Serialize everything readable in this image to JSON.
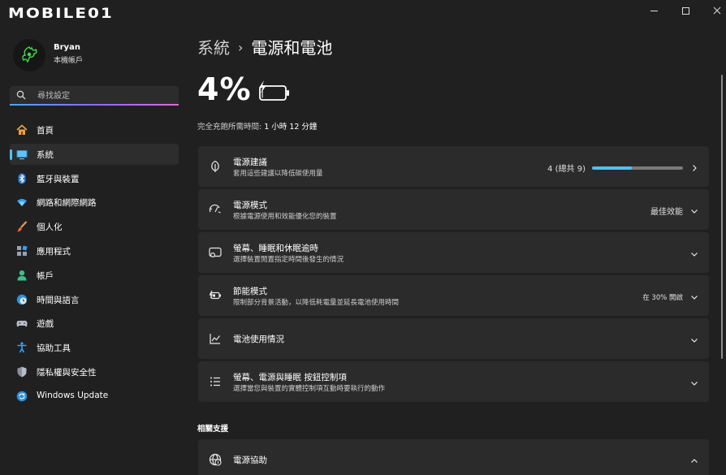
{
  "brand": {
    "logo_text": "MOBILE01"
  },
  "window": {
    "controls": [
      "minimize",
      "maximize",
      "close"
    ]
  },
  "profile": {
    "name": "Bryan",
    "account_type": "本機帳戶"
  },
  "search": {
    "placeholder": "尋找設定"
  },
  "sidebar": {
    "items": [
      {
        "label": "首頁",
        "icon": "home-icon",
        "active": false
      },
      {
        "label": "系統",
        "icon": "system-icon",
        "active": true
      },
      {
        "label": "藍牙與裝置",
        "icon": "bluetooth-icon",
        "active": false
      },
      {
        "label": "網路和網際網路",
        "icon": "wifi-icon",
        "active": false
      },
      {
        "label": "個人化",
        "icon": "brush-icon",
        "active": false
      },
      {
        "label": "應用程式",
        "icon": "apps-icon",
        "active": false
      },
      {
        "label": "帳戶",
        "icon": "account-icon",
        "active": false
      },
      {
        "label": "時間與語言",
        "icon": "globe-clock-icon",
        "active": false
      },
      {
        "label": "遊戲",
        "icon": "gamepad-icon",
        "active": false
      },
      {
        "label": "協助工具",
        "icon": "accessibility-icon",
        "active": false
      },
      {
        "label": "隱私權與安全性",
        "icon": "shield-icon",
        "active": false
      },
      {
        "label": "Windows Update",
        "icon": "update-icon",
        "active": false
      }
    ]
  },
  "breadcrumb": {
    "parent": "系統",
    "separator": "›",
    "current": "電源和電池"
  },
  "battery": {
    "percent_text": "4%",
    "charging": true,
    "level": 0.04,
    "charge_time_label": "完全充飽所需時間:",
    "charge_time_value": "1 小時 12 分鐘"
  },
  "cards": [
    {
      "title": "電源建議",
      "desc": "套用這些建議以降低碳使用量",
      "icon": "leaf-icon",
      "value": "4 (總共 9)",
      "progress": 0.44,
      "chevron": "right"
    },
    {
      "title": "電源模式",
      "desc": "根據電源使用和效能優化您的裝置",
      "icon": "power-mode-icon",
      "value": "最佳效能",
      "chevron": "down"
    },
    {
      "title": "螢幕、睡眠和休眠逾時",
      "desc": "選擇裝置閒置指定時間後發生的情況",
      "icon": "screen-sleep-icon",
      "chevron": "down"
    },
    {
      "title": "節能模式",
      "desc": "限制部分背景活動，以降低耗電量並延長電池使用時間",
      "icon": "battery-saver-icon",
      "value": "在 30% 開啟",
      "chevron": "down"
    },
    {
      "title": "電池使用情況",
      "icon": "usage-chart-icon",
      "chevron": "down"
    },
    {
      "title": "螢幕、電源與睡眠 按鈕控制項",
      "desc": "選擇當您與裝置的實體控制項互動時要執行的動作",
      "icon": "list-controls-icon",
      "chevron": "down"
    }
  ],
  "related": {
    "heading": "相關支援",
    "items": [
      {
        "title": "電源協助",
        "icon": "globe-help-icon",
        "chevron": "up"
      }
    ]
  },
  "colors": {
    "accent": "#4cc2ff",
    "background": "#202020",
    "card": "#2b2b2b"
  }
}
